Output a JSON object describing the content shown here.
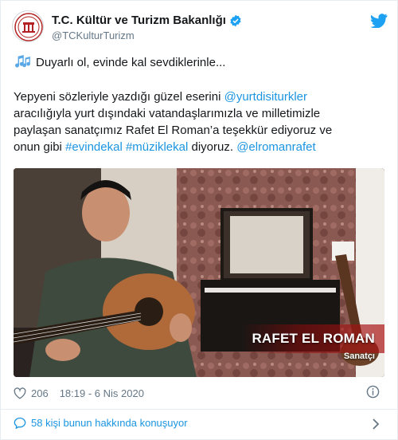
{
  "account": {
    "display_name": "T.C. Kültür ve Turizm Bakanlığı",
    "handle": "@TCKulturTurizm"
  },
  "tweet": {
    "line1": "Duyarlı ol, evinde kal sevdiklerinle...",
    "body": {
      "l1_text": "Yepyeni sözleriyle yazdığı güzel eserini ",
      "l1_link": "@yurtdisiturkler",
      "l2_text": " aracılığıyla yurt dışındaki vatandaşlarımızla ve milletimizle",
      "l3_text": "paylaşan sanatçımız Rafet El Roman’a teşekkür ediyoruz ve",
      "l4_text1": "onun gibi ",
      "l4_link1": "#evindekal",
      "l4_space": " ",
      "l4_link2": "#müziklekal",
      "l4_text2": " diyoruz. ",
      "l4_link3": "@elromanrafet"
    },
    "media": {
      "overlay_name": "RAFET EL ROMAN",
      "overlay_role": "Sanatçı"
    },
    "likes": "206",
    "time": "18:19 - 6 Nis 2020",
    "footer_text": "58 kişi bunun hakkında konuşuyor"
  },
  "colors": {
    "link": "#1b95e0",
    "text": "#14171a",
    "muted": "#657786"
  },
  "icons": [
    "ministry-logo-icon",
    "verified-badge-icon",
    "twitter-bird-icon",
    "music-notes-icon",
    "heart-icon",
    "info-icon",
    "speech-bubble-icon",
    "chevron-right-icon"
  ]
}
